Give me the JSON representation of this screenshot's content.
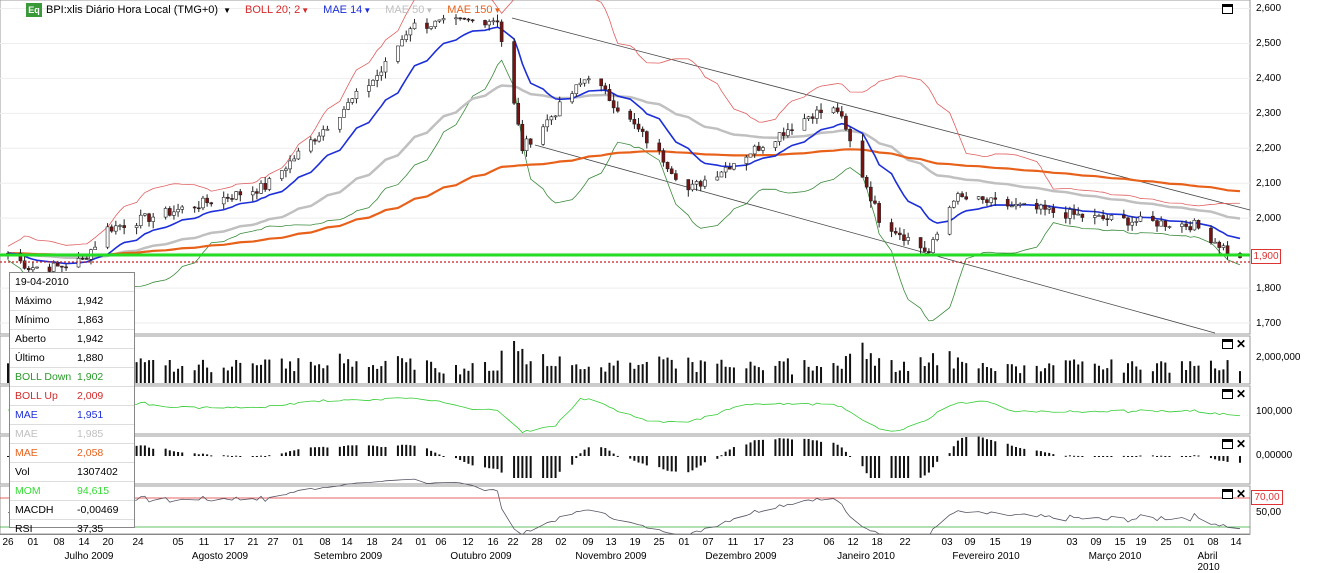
{
  "title": {
    "instrument": "BPI:xlis Diário Hora Local (TMG+0)",
    "logo": "Eq",
    "legend": [
      {
        "label": "BOLL 20; 2",
        "color": "#d42b2b"
      },
      {
        "label": "MAE 14",
        "color": "#1c2fd8"
      },
      {
        "label": "MAE 50",
        "color": "#c0c0c0"
      },
      {
        "label": "MAE 150",
        "color": "#e8611a"
      }
    ]
  },
  "price_axis": [
    "2,600",
    "2,500",
    "2,400",
    "2,300",
    "2,200",
    "2,100",
    "2,000",
    "1,900",
    "1,800",
    "1,700"
  ],
  "price_tag": "1,900",
  "volume_axis": "2,000,000",
  "mom_axis": "100,000",
  "macd_axis": "0,00000",
  "rsi_axis": [
    "70,00",
    "50,00"
  ],
  "date_days": [
    "26",
    "01",
    "08",
    "14",
    "20",
    "24",
    "05",
    "11",
    "17",
    "21",
    "27",
    "01",
    "08",
    "14",
    "18",
    "24",
    "01",
    "06",
    "12",
    "16",
    "22",
    "28",
    "02",
    "09",
    "13",
    "19",
    "25",
    "01",
    "07",
    "11",
    "17",
    "23",
    "06",
    "12",
    "18",
    "22",
    "03",
    "09",
    "15",
    "19",
    "03",
    "09",
    "15",
    "19",
    "25",
    "01",
    "08",
    "14"
  ],
  "date_months": [
    "Julho 2009",
    "Agosto 2009",
    "Setembro 2009",
    "Outubro 2009",
    "Novembro 2009",
    "Dezembro 2009",
    "Janeiro 2010",
    "Fevereiro 2010",
    "Março 2010",
    "Abril 2010"
  ],
  "infobox": {
    "date": "19-04-2010",
    "rows": [
      {
        "k": "Máximo",
        "v": "1,942",
        "color": "#000000"
      },
      {
        "k": "Mínimo",
        "v": "1,863",
        "color": "#000000"
      },
      {
        "k": "Aberto",
        "v": "1,942",
        "color": "#000000"
      },
      {
        "k": "Último",
        "v": "1,880",
        "color": "#000000"
      },
      {
        "k": "BOLL Down",
        "v": "1,902",
        "color": "#2a9a2a"
      },
      {
        "k": "BOLL Up",
        "v": "2,009",
        "color": "#d42b2b"
      },
      {
        "k": "MAE",
        "v": "1,951",
        "color": "#1c2fd8"
      },
      {
        "k": "MAE",
        "v": "1,985",
        "color": "#c0c0c0"
      },
      {
        "k": "MAE",
        "v": "2,058",
        "color": "#e8611a"
      },
      {
        "k": "Vol",
        "v": "1307402",
        "color": "#000000"
      },
      {
        "k": "MOM",
        "v": "94,615",
        "color": "#33dd33"
      },
      {
        "k": "MACDH",
        "v": "-0,00469",
        "color": "#000000"
      },
      {
        "k": "RSI",
        "v": "37,35",
        "color": "#000000"
      }
    ]
  },
  "chart_data": {
    "type": "candlestick",
    "instrument": "BPI:xlis",
    "ylim": [
      1.68,
      2.61
    ],
    "horizontal_level": 1.9,
    "key_points": [
      {
        "date": "2009-07-14",
        "close": 1.88
      },
      {
        "date": "2009-07-20",
        "close": 1.97
      },
      {
        "date": "2009-08-27",
        "close": 2.09
      },
      {
        "date": "2009-09-24",
        "close": 2.42
      },
      {
        "date": "2009-10-01",
        "close": 2.55
      },
      {
        "date": "2009-10-22",
        "close": 2.57
      },
      {
        "date": "2009-10-28",
        "close": 2.2
      },
      {
        "date": "2009-11-13",
        "close": 2.41
      },
      {
        "date": "2009-12-01",
        "close": 2.17
      },
      {
        "date": "2009-12-07",
        "close": 2.08
      },
      {
        "date": "2010-01-06",
        "close": 2.3
      },
      {
        "date": "2010-01-12",
        "close": 2.31
      },
      {
        "date": "2010-01-22",
        "close": 2.0
      },
      {
        "date": "2010-02-03",
        "close": 1.9
      },
      {
        "date": "2010-02-09",
        "close": 2.06
      },
      {
        "date": "2010-03-15",
        "close": 2.0
      },
      {
        "date": "2010-04-08",
        "close": 1.98
      },
      {
        "date": "2010-04-19",
        "close": 1.88
      }
    ]
  }
}
